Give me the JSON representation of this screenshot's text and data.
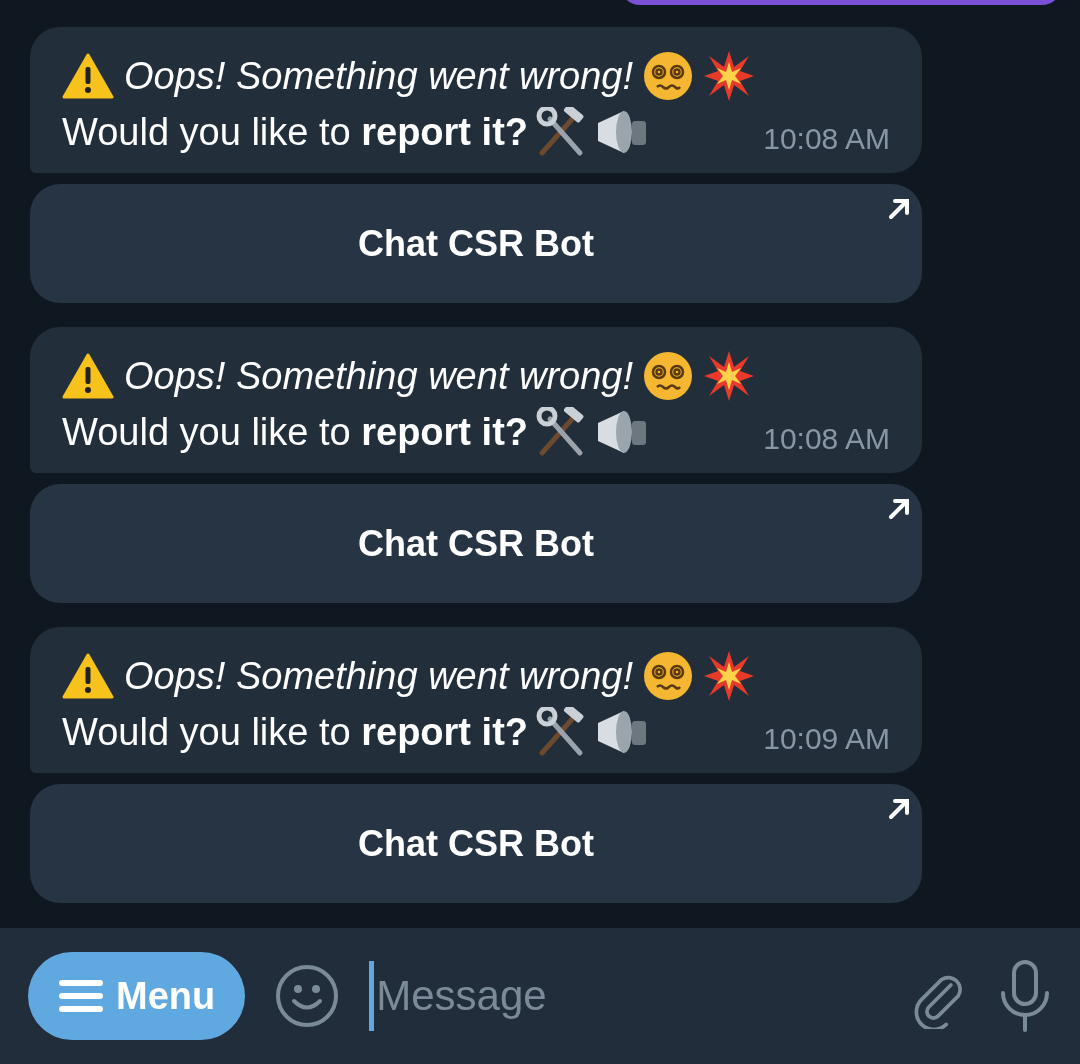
{
  "messages": [
    {
      "title": "Oops! Something went wrong!",
      "body": "Would you like to **report it?**",
      "time": "10:08 AM",
      "button": "Chat CSR Bot"
    },
    {
      "title": "Oops! Something went wrong!",
      "body": "Would you like to **report it?**",
      "time": "10:08 AM",
      "button": "Chat CSR Bot"
    },
    {
      "title": "Oops! Something went wrong!",
      "body": "Would you like to **report it?**",
      "time": "10:09 AM",
      "button": "Chat CSR Bot"
    }
  ],
  "composer": {
    "menu_button": "Menu",
    "placeholder": "Message"
  }
}
